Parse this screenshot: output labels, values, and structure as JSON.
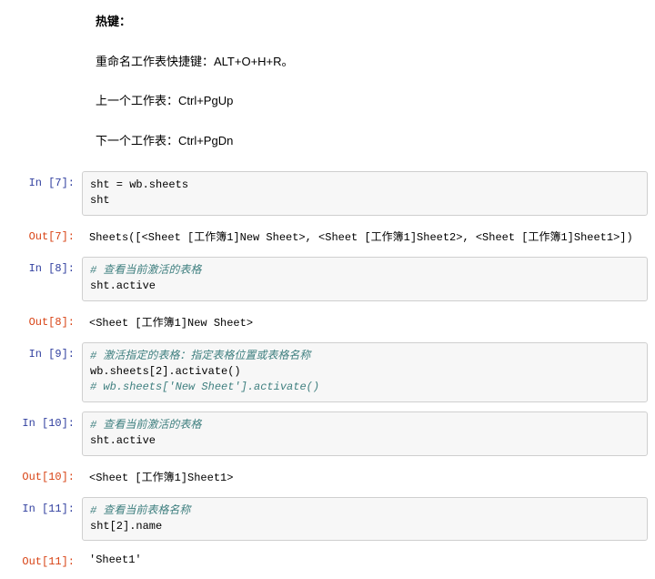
{
  "md": {
    "heading": "热键：",
    "p1": "重命名工作表快捷键：ALT+O+H+R。",
    "p2": "上一个工作表：Ctrl+PgUp",
    "p3": "下一个工作表：Ctrl+PgDn"
  },
  "cells": {
    "c7": {
      "in_prompt": "In [7]:",
      "line1": "sht = wb.sheets",
      "line2": "sht",
      "out_prompt": "Out[7]:",
      "out": "Sheets([<Sheet [工作簿1]New Sheet>, <Sheet [工作簿1]Sheet2>, <Sheet [工作簿1]Sheet1>])"
    },
    "c8": {
      "in_prompt": "In [8]:",
      "comment1": "# 查看当前激活的表格",
      "line2": "sht.active",
      "out_prompt": "Out[8]:",
      "out": "<Sheet [工作簿1]New Sheet>"
    },
    "c9": {
      "in_prompt": "In [9]:",
      "comment1": "# 激活指定的表格：指定表格位置或表格名称",
      "line2": "wb.sheets[2].activate()",
      "comment3": "# wb.sheets['New Sheet'].activate()"
    },
    "c10": {
      "in_prompt": "In [10]:",
      "comment1": "# 查看当前激活的表格",
      "line2": "sht.active",
      "out_prompt": "Out[10]:",
      "out": "<Sheet [工作簿1]Sheet1>"
    },
    "c11": {
      "in_prompt": "In [11]:",
      "comment1": "# 查看当前表格名称",
      "line2": "sht[2].name",
      "out_prompt": "Out[11]:",
      "out": "'Sheet1'"
    }
  }
}
